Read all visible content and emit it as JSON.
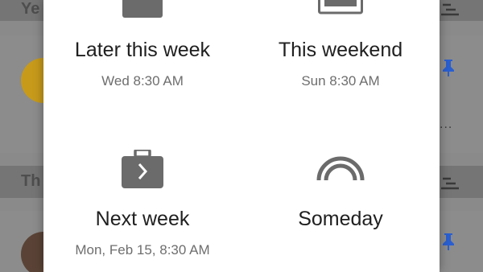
{
  "background": {
    "sections": [
      {
        "label": "Ye"
      },
      {
        "label": "Th"
      }
    ],
    "row_ellipsis": "..."
  },
  "dialog": {
    "options": [
      {
        "title": "Later this week",
        "subtitle": "Wed 8:30 AM",
        "icon": "calendar-icon"
      },
      {
        "title": "This weekend",
        "subtitle": "Sun 8:30 AM",
        "icon": "weekend-icon"
      },
      {
        "title": "Next week",
        "subtitle": "Mon, Feb 15, 8:30 AM",
        "icon": "briefcase-next-icon"
      },
      {
        "title": "Someday",
        "subtitle": "",
        "icon": "rainbow-icon"
      }
    ]
  },
  "colors": {
    "accent": "#2a5fd0",
    "icon_gray": "#6b6b6b",
    "avatar_yellow": "#c79a1a",
    "avatar_brown": "#5a4336"
  }
}
